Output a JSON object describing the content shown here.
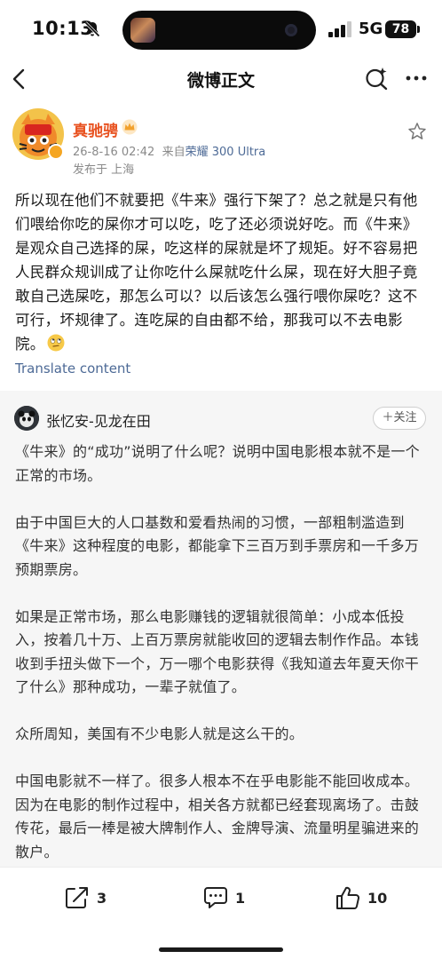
{
  "status_bar": {
    "time": "10:13",
    "network": "5G",
    "battery": "78"
  },
  "nav": {
    "title": "微博正文",
    "icons": [
      "back-icon",
      "ai-search-icon",
      "more-icon"
    ]
  },
  "post": {
    "author": "真驰骋",
    "meta_time": "26-8-16 02:42",
    "meta_from_prefix": "来自",
    "meta_from_device": "荣耀 300 Ultra",
    "location": "发布于 上海",
    "text": "所以现在他们不就要把《牛来》强行下架了？总之就是只有他们喂给你吃的屎你才可以吃，吃了还必须说好吃。而《牛来》是观众自己选择的屎，吃这样的屎就是坏了规矩。好不容易把人民群众规训成了让你吃什么屎就吃什么屎，现在好大胆子竟敢自己选屎吃，那怎么可以？以后该怎么强行喂你屎吃？这不可行，坏规律了。连吃屎的自由都不给，那我可以不去电影院。",
    "translate_label": "Translate content"
  },
  "quoted": {
    "author": "张忆安-见龙在田",
    "follow_label": "＋关注",
    "paragraphs": [
      "《牛来》的“成功”说明了什么呢？说明中国电影根本就不是一个正常的市场。",
      "由于中国巨大的人口基数和爱看热闹的习惯，一部粗制滥造到《牛来》这种程度的电影，都能拿下三百万到手票房和一千多万预期票房。",
      "如果是正常市场，那么电影赚钱的逻辑就很简单：小成本低投入，按着几十万、上百万票房就能收回的逻辑去制作作品。本钱收到手扭头做下一个，万一哪个电影获得《我知道去年夏天你干了什么》那种成功，一辈子就值了。",
      "众所周知，美国有不少电影人就是这么干的。",
      "中国电影就不一样了。很多人根本不在乎电影能不能回收成本。因为在电影的制作过程中，相关各方就都已经套现离场了。击鼓传花，最后一棒是被大牌制作人、金牌导演、流量明星骗进来的散户。"
    ]
  },
  "actions": {
    "repost_count": "3",
    "comment_count": "1",
    "like_count": "10"
  },
  "colors": {
    "author_name": "#e8511f",
    "link": "#4d6a96",
    "quote_bg": "#f6f6f6"
  }
}
